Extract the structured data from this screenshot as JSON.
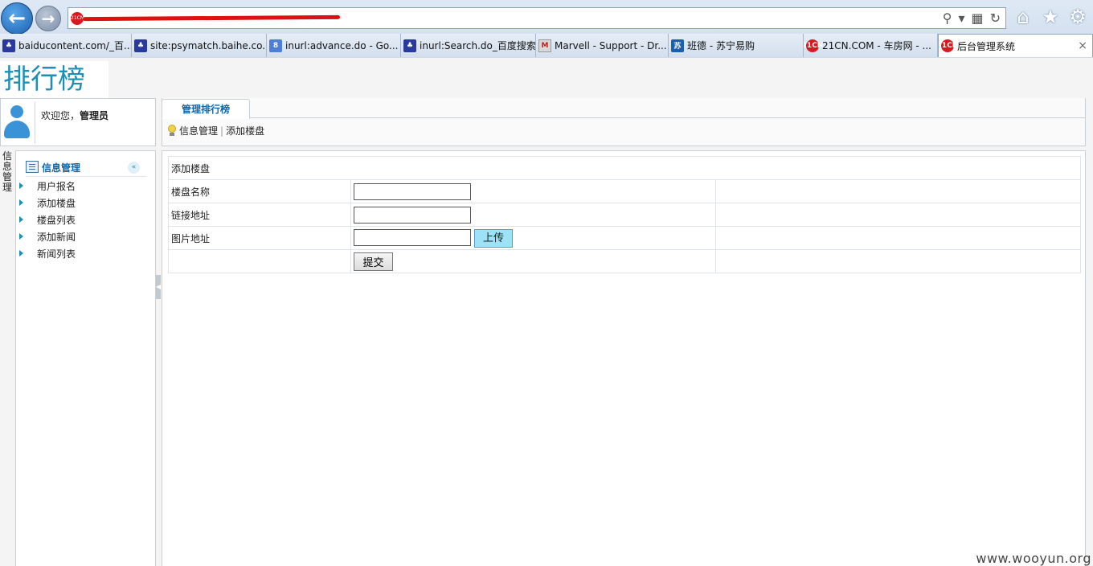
{
  "browser": {
    "tabs": [
      {
        "label": "baiducontent.com/_百...",
        "icon": "paw-icon",
        "width": 164
      },
      {
        "label": "site:psymatch.baihe.co...",
        "icon": "paw-icon",
        "width": 168
      },
      {
        "label": "inurl:advance.do - Go...",
        "icon": "google-icon",
        "width": 167
      },
      {
        "label": "inurl:Search.do_百度搜索",
        "icon": "paw-icon",
        "width": 168
      },
      {
        "label": "Marvell - Support - Dr...",
        "icon": "marvell-icon",
        "width": 165
      },
      {
        "label": "班德 - 苏宁易购",
        "icon": "suning-icon",
        "width": 168
      },
      {
        "label": "21CN.COM - 车房网 - ...",
        "icon": "21cn-icon",
        "width": 167
      },
      {
        "label": "后台管理系统",
        "icon": "21cn-icon",
        "width": 193,
        "active": true
      }
    ],
    "favicon_text": "21CN"
  },
  "header": {
    "logo_text": "排行榜"
  },
  "user": {
    "welcome_prefix": "欢迎您，",
    "username": "管理员"
  },
  "sidebar": {
    "vertical_tab": "信息管理",
    "section_title": "信息管理",
    "collapse_glyph": "«",
    "items": [
      {
        "label": "用户报名"
      },
      {
        "label": "添加楼盘"
      },
      {
        "label": "楼盘列表"
      },
      {
        "label": "添加新闻"
      },
      {
        "label": "新闻列表"
      }
    ]
  },
  "content": {
    "tab_label": "管理排行榜",
    "breadcrumb": [
      "信息管理",
      "添加楼盘"
    ],
    "breadcrumb_sep": "|",
    "form": {
      "title": "添加楼盘",
      "fields": [
        {
          "label": "楼盘名称",
          "value": ""
        },
        {
          "label": "链接地址",
          "value": ""
        },
        {
          "label": "图片地址",
          "value": ""
        }
      ],
      "upload_button": "上传",
      "submit_button": "提交"
    }
  },
  "watermark": "www.wooyun.org"
}
